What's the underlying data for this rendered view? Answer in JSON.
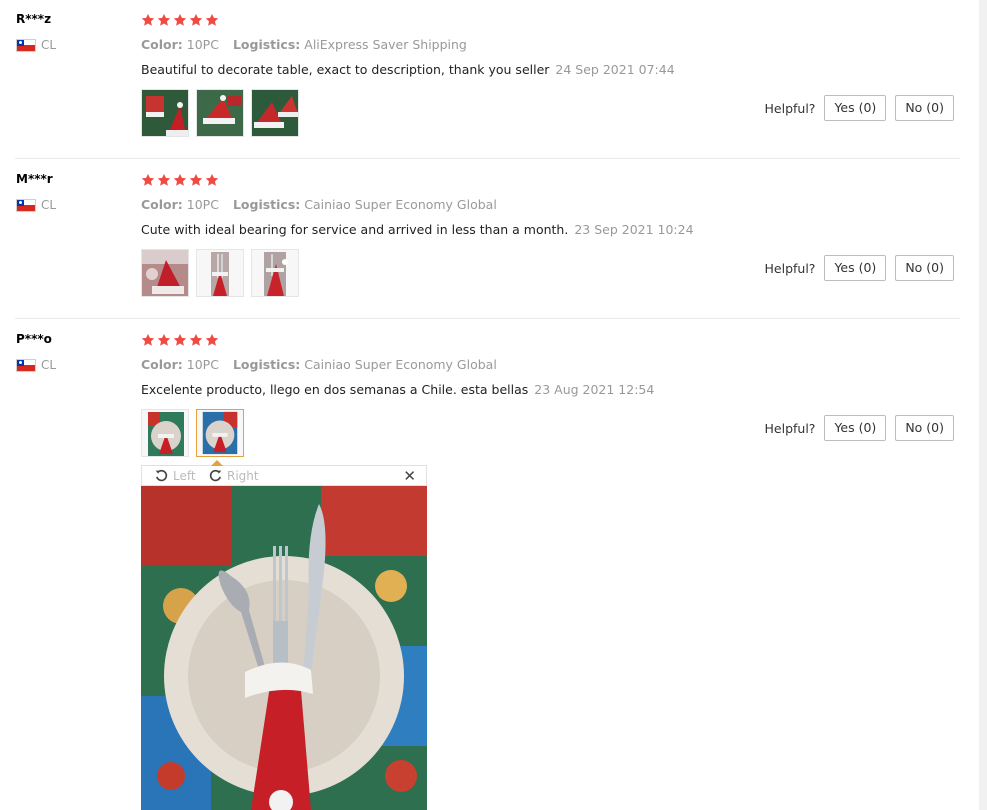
{
  "reviews": [
    {
      "user": "R***z",
      "country": "CL",
      "rating": 5,
      "color_label": "Color:",
      "color_value": "10PC",
      "logistics_label": "Logistics:",
      "logistics_value": "AliExpress Saver Shipping",
      "text": "Beautiful to decorate table, exact to description, thank you seller",
      "date": "24 Sep 2021 07:44",
      "photos": [
        "santa-hat-photo",
        "santa-hat-photo",
        "santa-hat-photo"
      ],
      "helpful_label": "Helpful?",
      "yes_label": "Yes (0)",
      "no_label": "No (0)"
    },
    {
      "user": "M***r",
      "country": "CL",
      "rating": 5,
      "color_label": "Color:",
      "color_value": "10PC",
      "logistics_label": "Logistics:",
      "logistics_value": "Cainiao Super Economy Global",
      "text": "Cute with ideal bearing for service and arrived in less than a month.",
      "date": "23 Sep 2021 10:24",
      "photos": [
        "santa-hat-photo",
        "cutlery-hat-photo",
        "cutlery-hat-photo"
      ],
      "helpful_label": "Helpful?",
      "yes_label": "Yes (0)",
      "no_label": "No (0)"
    },
    {
      "user": "P***o",
      "country": "CL",
      "rating": 5,
      "color_label": "Color:",
      "color_value": "10PC",
      "logistics_label": "Logistics:",
      "logistics_value": "Cainiao Super Economy Global",
      "text": "Excelente producto, llego en dos semanas a Chile. esta bellas",
      "date": "23 Aug 2021 12:54",
      "photos": [
        "plate-cutlery-photo",
        "plate-cutlery-photo"
      ],
      "selected_photo": 1,
      "helpful_label": "Helpful?",
      "yes_label": "Yes (0)",
      "no_label": "No (0)"
    }
  ],
  "viewer": {
    "rotate_left_label": "Left",
    "rotate_right_label": "Right",
    "close_symbol": "✕",
    "image": "plate-cutlery-santa-hat-photo"
  },
  "colors": {
    "star": "#f04a45",
    "muted_text": "#999999",
    "selected_border": "#e3a23a"
  }
}
